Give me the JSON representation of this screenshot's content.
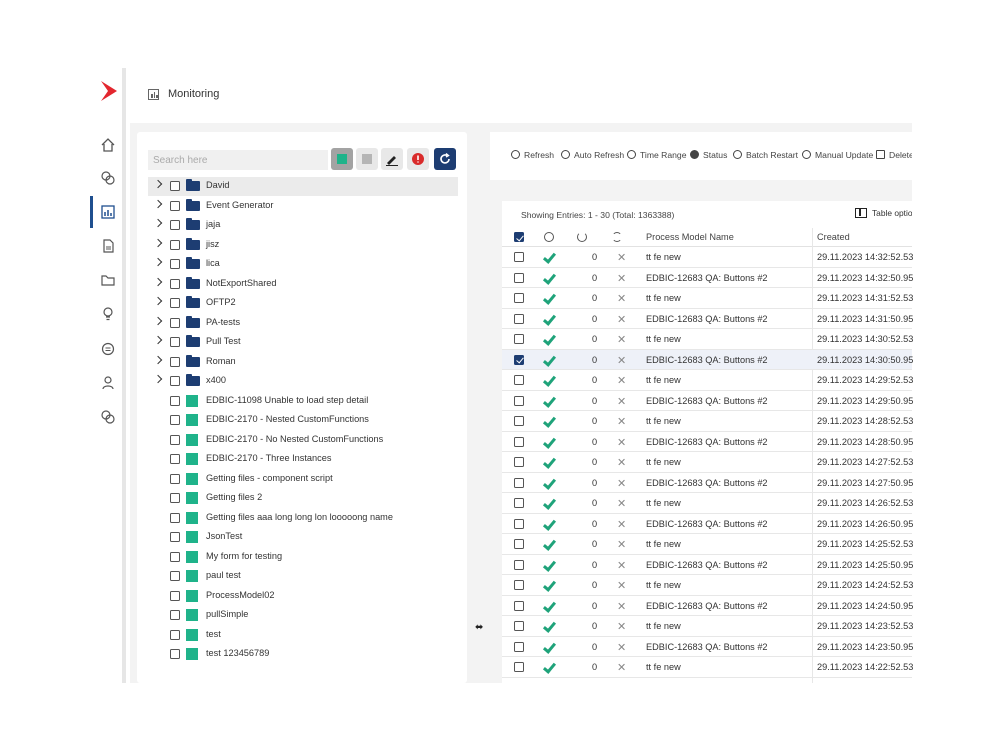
{
  "header": {
    "title": "Monitoring"
  },
  "nav": {
    "items": [
      "home-icon",
      "workflow-icon",
      "monitoring-icon",
      "document-icon",
      "folder-icon",
      "bulb-icon",
      "coin-icon",
      "user-icon",
      "settings-icon"
    ],
    "accent": "#1f4f8f",
    "brand": "#e3262e"
  },
  "tree": {
    "search_placeholder": "Search here",
    "toolbar": [
      "select-green-icon",
      "select-gray-icon",
      "edit-icon",
      "error-icon",
      "refresh-icon"
    ],
    "folders": [
      "David",
      "Event Generator",
      "jaja",
      "jisz",
      "lica",
      "NotExportShared",
      "OFTP2",
      "PA-tests",
      "Pull Test",
      "Roman",
      "x400"
    ],
    "models": [
      "EDBIC-11098 Unable to load step detail",
      "EDBIC-2170 - Nested CustomFunctions",
      "EDBIC-2170 - No Nested CustomFunctions",
      "EDBIC-2170 - Three Instances",
      "Getting files - component script",
      "Getting files 2",
      "Getting files aaa long long lon looooong name",
      "JsonTest",
      "My form for testing",
      "paul test",
      "ProcessModel02",
      "pullSimple",
      "test",
      "test 123456789"
    ],
    "folder_color": "#1d3d72",
    "model_color": "#1fb38a"
  },
  "toolbar": {
    "refresh": "Refresh",
    "auto_refresh": "Auto Refresh",
    "time_range": "Time Range",
    "status": "Status",
    "batch_restart": "Batch Restart",
    "manual_update": "Manual Update",
    "delete": "Delete"
  },
  "grid": {
    "showing": "Showing Entries: 1 - 30 (Total: 1363388)",
    "table_options": "Table options",
    "col_name": "Process Model Name",
    "col_created": "Created",
    "rows": [
      {
        "count": "0",
        "name": "tt fe new",
        "created": "29.11.2023 14:32:52.53",
        "checked": false
      },
      {
        "count": "0",
        "name": "EDBIC-12683 QA: Buttons #2",
        "created": "29.11.2023 14:32:50.95",
        "checked": false
      },
      {
        "count": "0",
        "name": "tt fe new",
        "created": "29.11.2023 14:31:52.53",
        "checked": false
      },
      {
        "count": "0",
        "name": "EDBIC-12683 QA: Buttons #2",
        "created": "29.11.2023 14:31:50.95",
        "checked": false
      },
      {
        "count": "0",
        "name": "tt fe new",
        "created": "29.11.2023 14:30:52.53",
        "checked": false
      },
      {
        "count": "0",
        "name": "EDBIC-12683 QA: Buttons #2",
        "created": "29.11.2023 14:30:50.95",
        "checked": true
      },
      {
        "count": "0",
        "name": "tt fe new",
        "created": "29.11.2023 14:29:52.53",
        "checked": false
      },
      {
        "count": "0",
        "name": "EDBIC-12683 QA: Buttons #2",
        "created": "29.11.2023 14:29:50.95",
        "checked": false
      },
      {
        "count": "0",
        "name": "tt fe new",
        "created": "29.11.2023 14:28:52.53",
        "checked": false
      },
      {
        "count": "0",
        "name": "EDBIC-12683 QA: Buttons #2",
        "created": "29.11.2023 14:28:50.95",
        "checked": false
      },
      {
        "count": "0",
        "name": "tt fe new",
        "created": "29.11.2023 14:27:52.53",
        "checked": false
      },
      {
        "count": "0",
        "name": "EDBIC-12683 QA: Buttons #2",
        "created": "29.11.2023 14:27:50.95",
        "checked": false
      },
      {
        "count": "0",
        "name": "tt fe new",
        "created": "29.11.2023 14:26:52.53",
        "checked": false
      },
      {
        "count": "0",
        "name": "EDBIC-12683 QA: Buttons #2",
        "created": "29.11.2023 14:26:50.95",
        "checked": false
      },
      {
        "count": "0",
        "name": "tt fe new",
        "created": "29.11.2023 14:25:52.53",
        "checked": false
      },
      {
        "count": "0",
        "name": "EDBIC-12683 QA: Buttons #2",
        "created": "29.11.2023 14:25:50.95",
        "checked": false
      },
      {
        "count": "0",
        "name": "tt fe new",
        "created": "29.11.2023 14:24:52.53",
        "checked": false
      },
      {
        "count": "0",
        "name": "EDBIC-12683 QA: Buttons #2",
        "created": "29.11.2023 14:24:50.95",
        "checked": false
      },
      {
        "count": "0",
        "name": "tt fe new",
        "created": "29.11.2023 14:23:52.53",
        "checked": false
      },
      {
        "count": "0",
        "name": "EDBIC-12683 QA: Buttons #2",
        "created": "29.11.2023 14:23:50.95",
        "checked": false
      },
      {
        "count": "0",
        "name": "tt fe new",
        "created": "29.11.2023 14:22:52.53",
        "checked": false
      }
    ]
  }
}
